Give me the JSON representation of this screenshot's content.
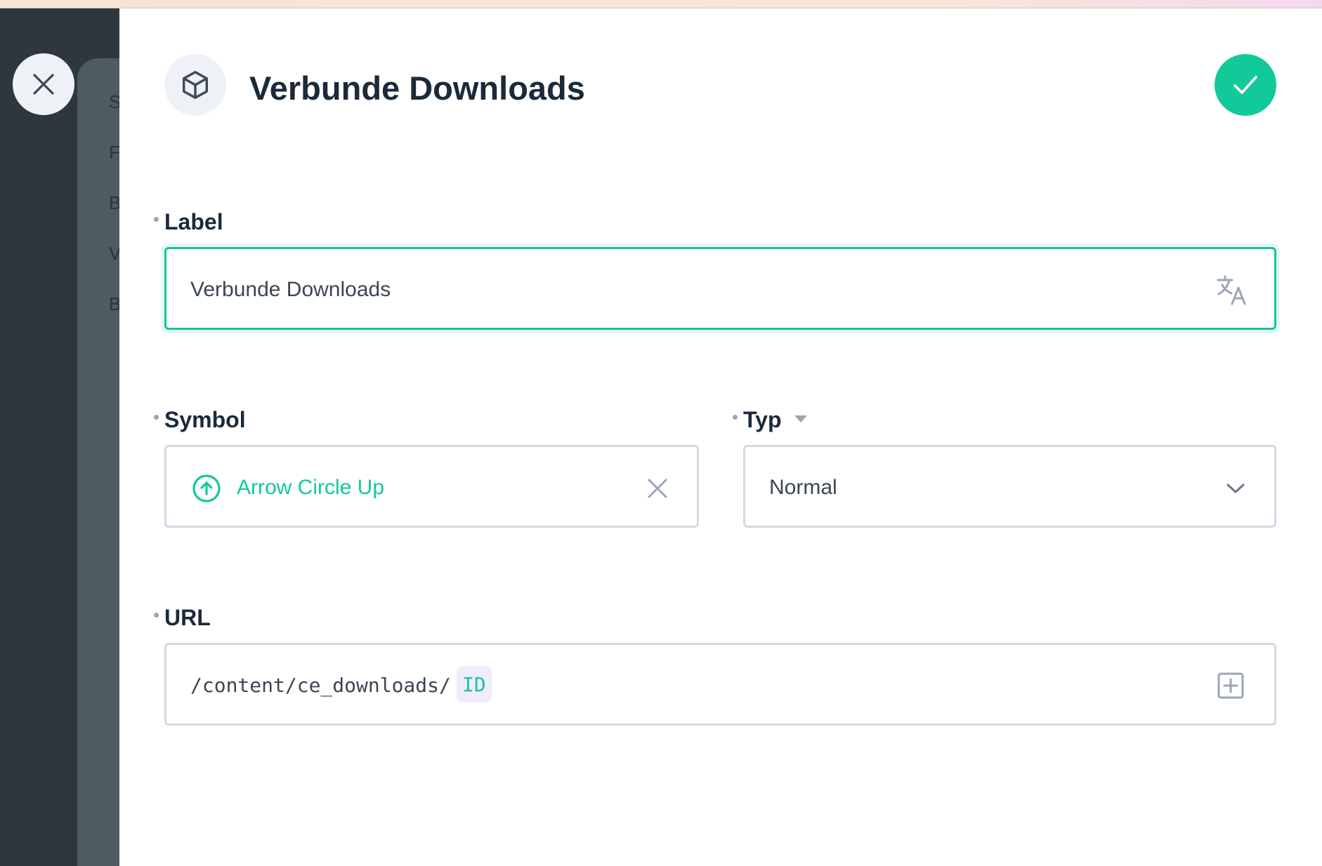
{
  "dialog": {
    "title": "Verbunde Downloads",
    "header_icon": "cube-icon",
    "close_icon": "close-icon",
    "confirm_icon": "check-icon"
  },
  "background_menu": {
    "items": [
      "S",
      "F",
      "B",
      "V",
      "B"
    ]
  },
  "fields": {
    "label": {
      "label": "Label",
      "value": "Verbunde Downloads",
      "icon": "translate-icon"
    },
    "symbol": {
      "label": "Symbol",
      "value": "Arrow Circle Up",
      "icon": "arrow-circle-up-icon",
      "clear_icon": "clear-icon"
    },
    "type": {
      "label": "Typ",
      "value": "Normal",
      "label_icon": "caret-down-icon",
      "icon": "chevron-down-icon"
    },
    "url": {
      "label": "URL",
      "value": "/content/ce_downloads/",
      "token": "ID",
      "icon": "add-square-icon"
    }
  },
  "colors": {
    "accent": "#12c99a",
    "title": "#1b2a3b",
    "border": "#d3dae4",
    "backdrop": "#2d373d"
  }
}
